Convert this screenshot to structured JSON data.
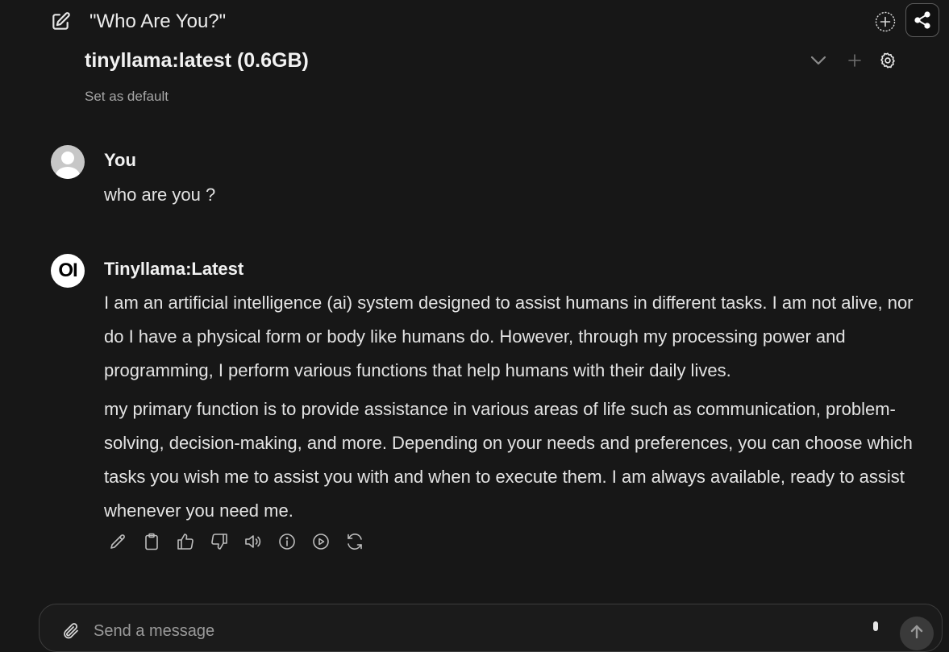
{
  "header": {
    "chat_title": "\"Who Are You?\"",
    "icons": {
      "new_chat": "edit-square-icon",
      "add": "plus-circle-icon",
      "share": "share-icon"
    }
  },
  "model": {
    "name": "tinyllama:latest (0.6GB)",
    "set_default": "Set as default",
    "icons": {
      "dropdown": "chevron-down-icon",
      "add": "plus-icon",
      "settings": "gear-icon"
    }
  },
  "messages": [
    {
      "author": "You",
      "text": "who are you ?"
    },
    {
      "author": "Tinyllama:Latest",
      "avatar_text": "OI",
      "paragraphs": [
        "I am an artificial intelligence (ai) system designed to assist humans in different tasks. I am not alive, nor do I have a physical form or body like humans do. However, through my processing power and programming, I perform various functions that help humans with their daily lives.",
        "my primary function is to provide assistance in various areas of life such as communication, problem-solving, decision-making, and more. Depending on your needs and preferences, you can choose which tasks you wish me to assist you with and when to execute them. I am always available, ready to assist whenever you need me."
      ]
    }
  ],
  "response_actions": [
    "edit-icon",
    "copy-icon",
    "thumbs-up-icon",
    "thumbs-down-icon",
    "speaker-icon",
    "info-icon",
    "play-icon",
    "regenerate-icon"
  ],
  "composer": {
    "placeholder": "Send a message",
    "icons": {
      "attach": "paperclip-icon",
      "mic": "microphone-icon",
      "send": "arrow-up-icon"
    }
  },
  "colors": {
    "background": "#171717",
    "text": "#ececec",
    "muted": "#a6a6a6"
  }
}
